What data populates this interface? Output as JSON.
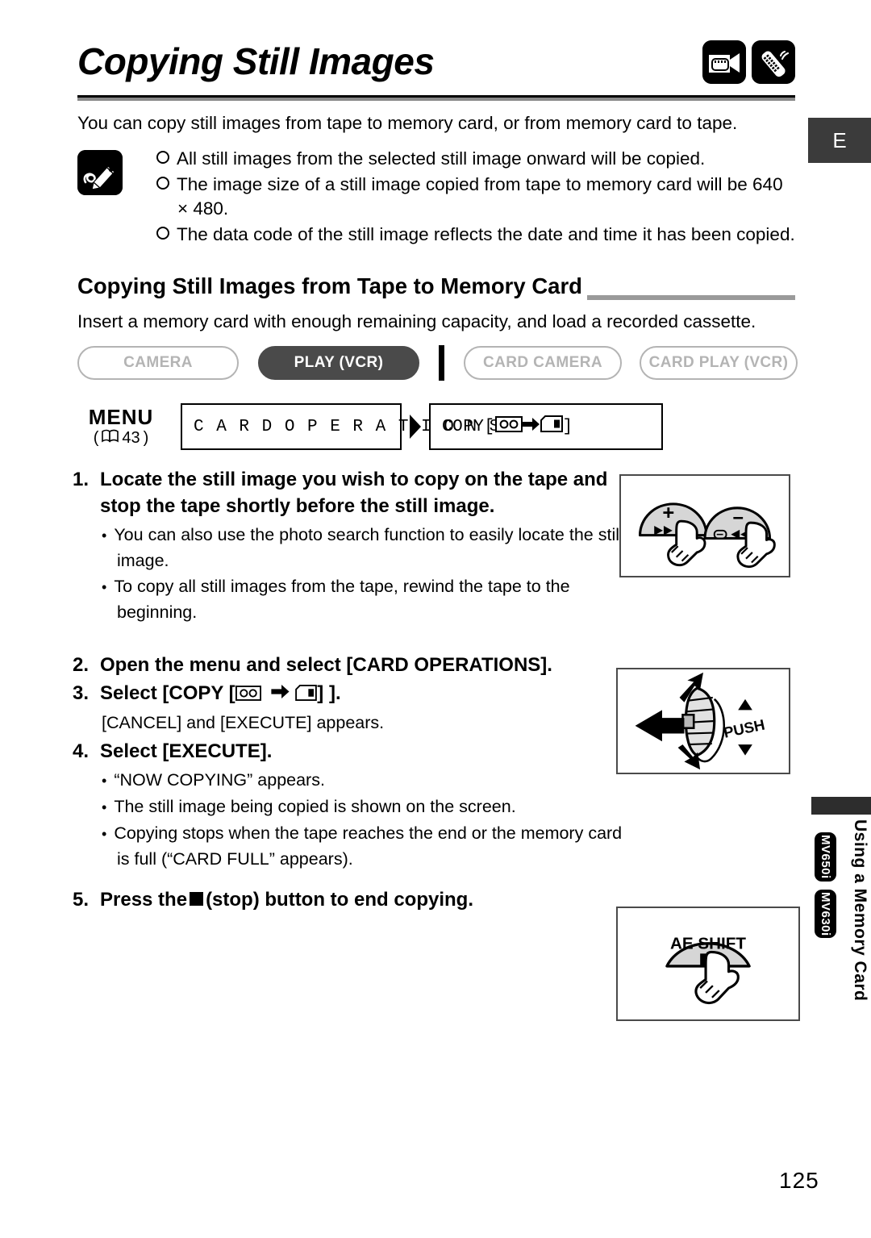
{
  "page": {
    "title": "Copying Still Images",
    "number": "125",
    "language_tab": "E",
    "header_icons": [
      "camcorder-icon",
      "remote-control-icon"
    ]
  },
  "intro": "You can copy still images from tape to memory card, or from memory card to tape.",
  "notes": {
    "icon": "memo-pencil-icon",
    "items": [
      "All still images from the selected still image onward will be copied.",
      "The image size of a still image copied from tape to memory card will be 640 × 480.",
      "The data code of the still image reflects the date and time it has been copied."
    ]
  },
  "section": {
    "heading": "Copying Still Images from Tape to Memory Card",
    "intro": "Insert a memory card with enough remaining capacity, and load a recorded cassette."
  },
  "mode_buttons": [
    {
      "label": "CAMERA",
      "active": false
    },
    {
      "label": "PLAY (VCR)",
      "active": true
    },
    {
      "label": "CARD CAMERA",
      "active": false
    },
    {
      "label": "CARD PLAY (VCR)",
      "active": false
    }
  ],
  "menu_path": {
    "menu_word": "MENU",
    "reference_open": "(",
    "reference_page": "43",
    "reference_close": ")",
    "book_icon": "book-icon",
    "box1": "C A R D   O P E R A T I O N S",
    "arrow": "❯",
    "box2_prefix": "COPY[",
    "box2_suffix": "]",
    "box2_from_icon": "cassette-tape-icon",
    "box2_to_icon": "memory-card-icon"
  },
  "steps": [
    {
      "num": "1.",
      "text": "Locate the still image you wish to copy on the tape and stop the tape shortly before the still image.",
      "bullets": [
        "You can also use the photo search function to easily locate the still image.",
        "To copy all still images from the tape, rewind the tape to the beginning."
      ]
    },
    {
      "num": "2.",
      "text": "Open the menu and select [CARD OPERATIONS]."
    },
    {
      "num": "3.",
      "text_prefix": "Select [COPY [",
      "text_suffix": "] ].",
      "from_icon": "cassette-tape-icon",
      "to_icon": "memory-card-icon",
      "note": "[CANCEL] and [EXECUTE] appears."
    },
    {
      "num": "4.",
      "text": "Select [EXECUTE].",
      "bullets": [
        "“NOW COPYING” appears.",
        "The still image being copied is shown on the screen.",
        "Copying stops when the tape reaches the end or the memory card is full (“CARD FULL” appears)."
      ]
    },
    {
      "num": "5.",
      "text_prefix": "Press the",
      "text_suffix": "(stop) button to end copying.",
      "icon": "stop-square-icon"
    }
  ],
  "illustrations": [
    {
      "name": "ff-rew-buttons-illustration",
      "labels": [
        "+",
        "−"
      ],
      "sub_labels": [
        "fast-forward-arrows",
        "rewind-arrows"
      ]
    },
    {
      "name": "selector-dial-illustration",
      "labels": [
        "PUSH"
      ]
    },
    {
      "name": "ae-shift-stop-button-illustration",
      "labels": [
        "AE SHIFT"
      ]
    }
  ],
  "side_tab": {
    "text": "Using a Memory Card",
    "badges": [
      "MV650i",
      "MV630i"
    ]
  }
}
